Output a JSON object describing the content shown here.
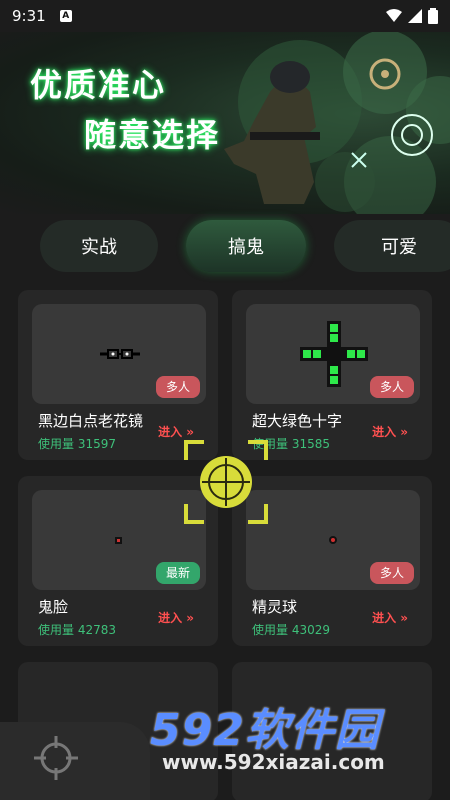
{
  "status": {
    "time": "9:31",
    "badge": "A"
  },
  "banner": {
    "line1": "优质准心",
    "line2": "随意选择"
  },
  "tabs": [
    {
      "label": "实战",
      "selected": false
    },
    {
      "label": "搞鬼",
      "selected": true
    },
    {
      "label": "可爱",
      "selected": false
    }
  ],
  "cards": [
    {
      "name": "黑边白点老花镜",
      "usage": "使用量 31597",
      "tag": "多人",
      "tag_color": "#c9565c",
      "enter": "进入 »"
    },
    {
      "name": "超大绿色十字",
      "usage": "使用量 31585",
      "tag": "多人",
      "tag_color": "#c9565c",
      "enter": "进入 »"
    },
    {
      "name": "鬼脸",
      "usage": "使用量 42783",
      "tag": "最新",
      "tag_color": "#33a66b",
      "enter": "进入 »"
    },
    {
      "name": "精灵球",
      "usage": "使用量 43029",
      "tag": "多人",
      "tag_color": "#c9565c",
      "enter": "进入 »"
    }
  ],
  "watermark": {
    "big": "592软件园",
    "small": "www.592xiazai.com"
  },
  "colors": {
    "accent_green": "#3ec07a",
    "enter_red": "#ff5050",
    "fab_yellow": "#d8dc3a"
  }
}
